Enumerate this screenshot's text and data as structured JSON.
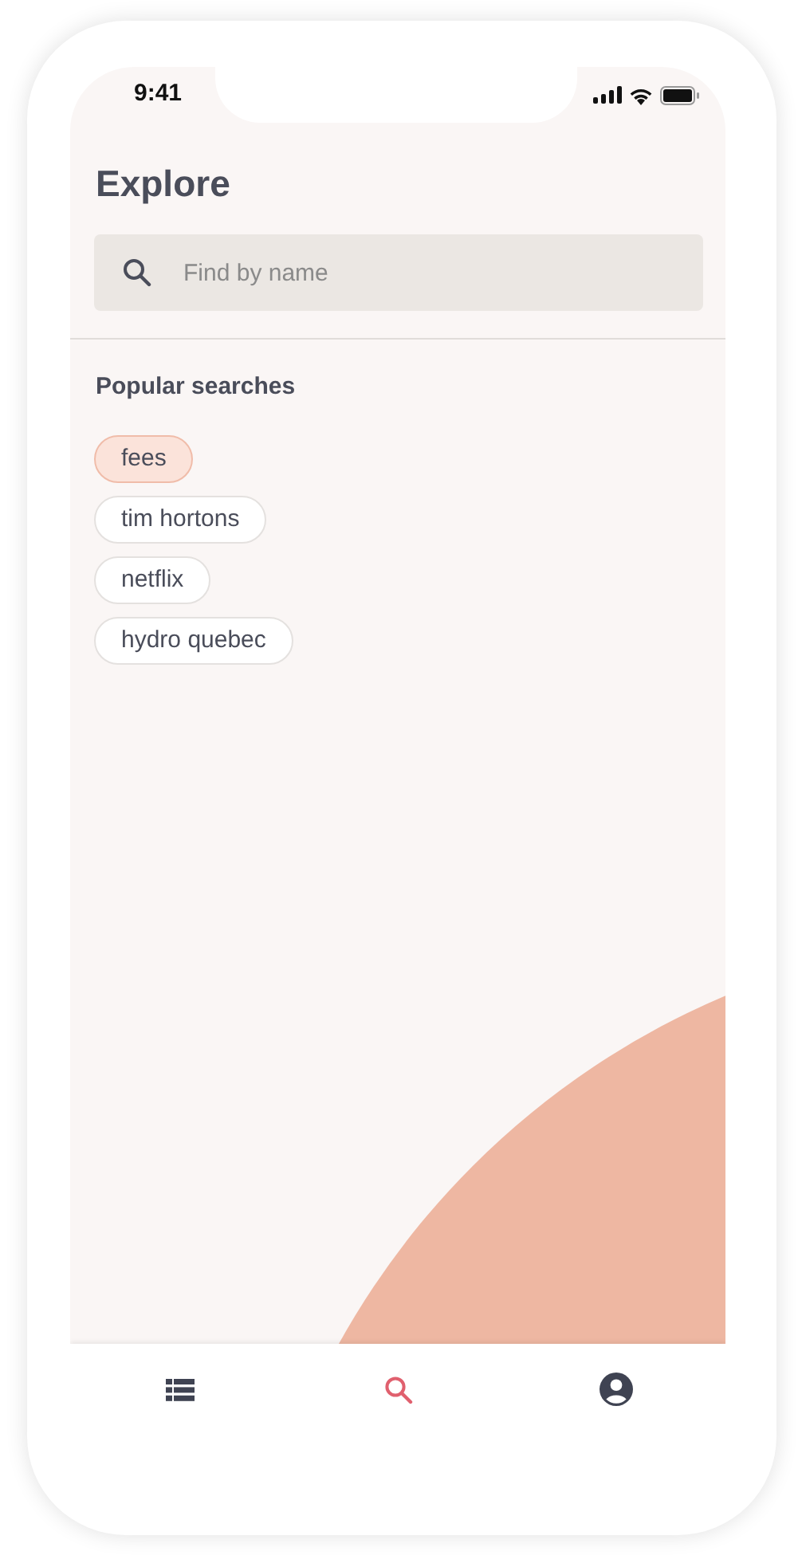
{
  "status_bar": {
    "time": "9:41"
  },
  "header": {
    "title": "Explore"
  },
  "search": {
    "placeholder": "Find by name"
  },
  "popular": {
    "heading": "Popular searches",
    "chips": [
      {
        "label": "fees",
        "selected": true
      },
      {
        "label": "tim hortons",
        "selected": false
      },
      {
        "label": "netflix",
        "selected": false
      },
      {
        "label": "hydro quebec",
        "selected": false
      }
    ]
  },
  "tab_bar": [
    {
      "kind": "list",
      "selected": false
    },
    {
      "kind": "search",
      "selected": true
    },
    {
      "kind": "account",
      "selected": false
    }
  ]
}
